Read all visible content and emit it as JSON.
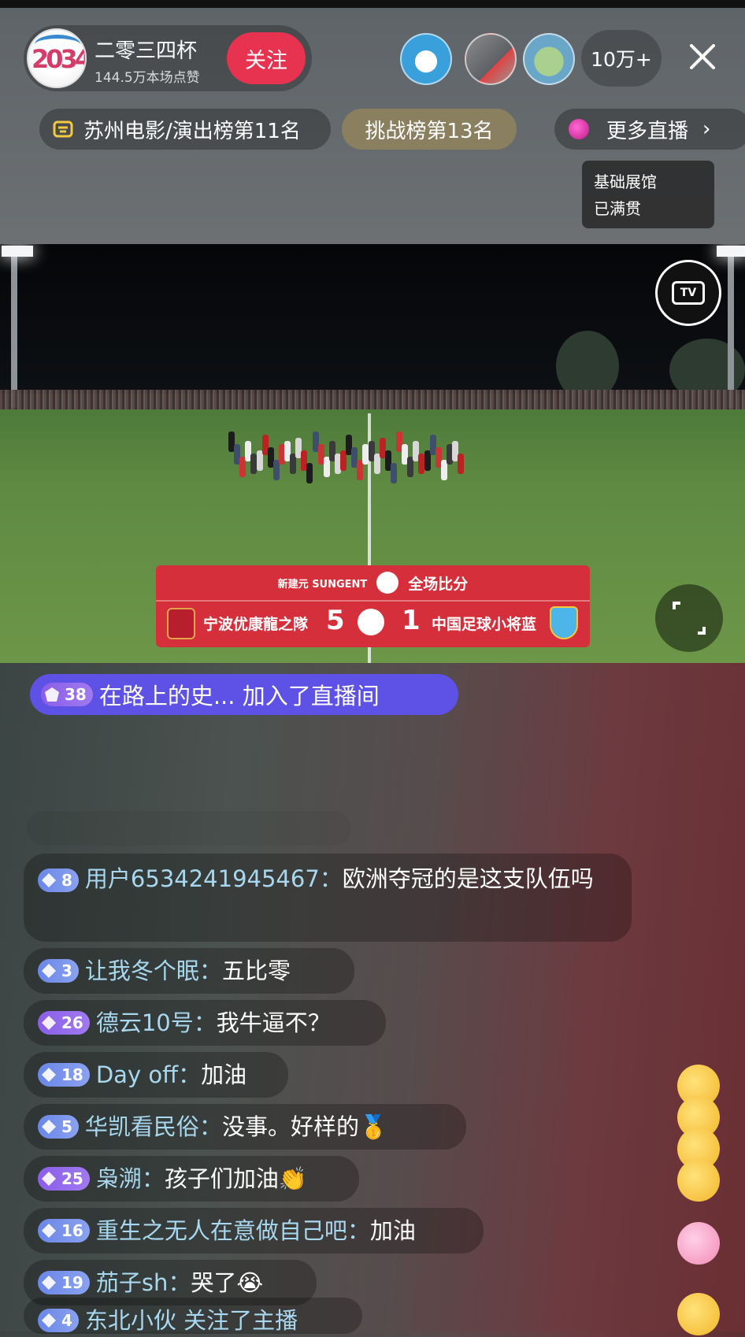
{
  "host": {
    "name": "二零三四杯",
    "likes": "144.5万本场点赞",
    "follow_label": "关注",
    "avatar_icon": "2034-cup-logo-icon"
  },
  "viewers": {
    "count": "10万+"
  },
  "ranks": {
    "city_rank": "苏州电影/演出榜第11名",
    "challenge_rank": "挑战榜第13名",
    "more_live": "更多直播",
    "more_live_chevron": "›"
  },
  "tooltip": {
    "line1": "基础展馆",
    "line2": "已满贯"
  },
  "video": {
    "tv_label": "TV"
  },
  "scoreboard": {
    "brand": "新建元 SUNGENT",
    "title": "全场比分",
    "home_team": "宁波优康龍之隊",
    "home_score": "5",
    "away_score": "1",
    "away_team": "中国足球小将蓝"
  },
  "join_notice": {
    "level": "38",
    "text": "在路上的史... 加入了直播间"
  },
  "chat": [
    {
      "level": "8",
      "badge": "blue",
      "user": "用户6534241945467：",
      "text": "欧洲夺冠的是这支队伍吗"
    },
    {
      "level": "3",
      "badge": "blue",
      "user": "让我冬个眠：",
      "text": "五比零"
    },
    {
      "level": "26",
      "badge": "purple",
      "user": "德云10号：",
      "text": "我牛逼不？"
    },
    {
      "level": "18",
      "badge": "blue",
      "user": "Day off：",
      "text": "加油"
    },
    {
      "level": "5",
      "badge": "blue",
      "user": "华凯看民俗：",
      "text": "没事。好样的🥇"
    },
    {
      "level": "25",
      "badge": "purple",
      "user": "枭溯：",
      "text": "孩子们加油👏"
    },
    {
      "level": "16",
      "badge": "blue",
      "user": "重生之无人在意做自己吧：",
      "text": "加油"
    },
    {
      "level": "19",
      "badge": "blue",
      "user": "茄子sh：",
      "text": "哭了😭"
    },
    {
      "level": "4",
      "badge": "blue",
      "user": "东北小伙 关注了主播",
      "text": ""
    }
  ],
  "colors": {
    "follow": "#e7334f",
    "join_pill": "#5d51e6",
    "scoreboard": "#d62f3c",
    "username": "#a8d8ef"
  }
}
